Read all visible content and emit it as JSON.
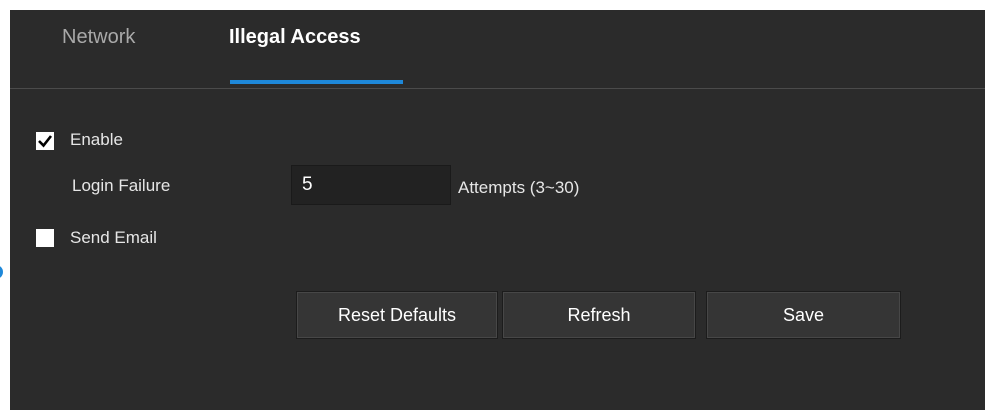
{
  "tabs": [
    {
      "label": "Network",
      "active": false
    },
    {
      "label": "Illegal Access",
      "active": true
    }
  ],
  "form": {
    "enable": {
      "label": "Enable",
      "checked": true
    },
    "login_failure": {
      "label": "Login Failure",
      "value": "5",
      "suffix": "Attempts (3~30)"
    },
    "send_email": {
      "label": "Send Email",
      "checked": false
    }
  },
  "buttons": {
    "reset": "Reset Defaults",
    "refresh": "Refresh",
    "save": "Save"
  },
  "colors": {
    "background": "#2b2b2b",
    "accent": "#1e88d9",
    "button": "#353535"
  }
}
